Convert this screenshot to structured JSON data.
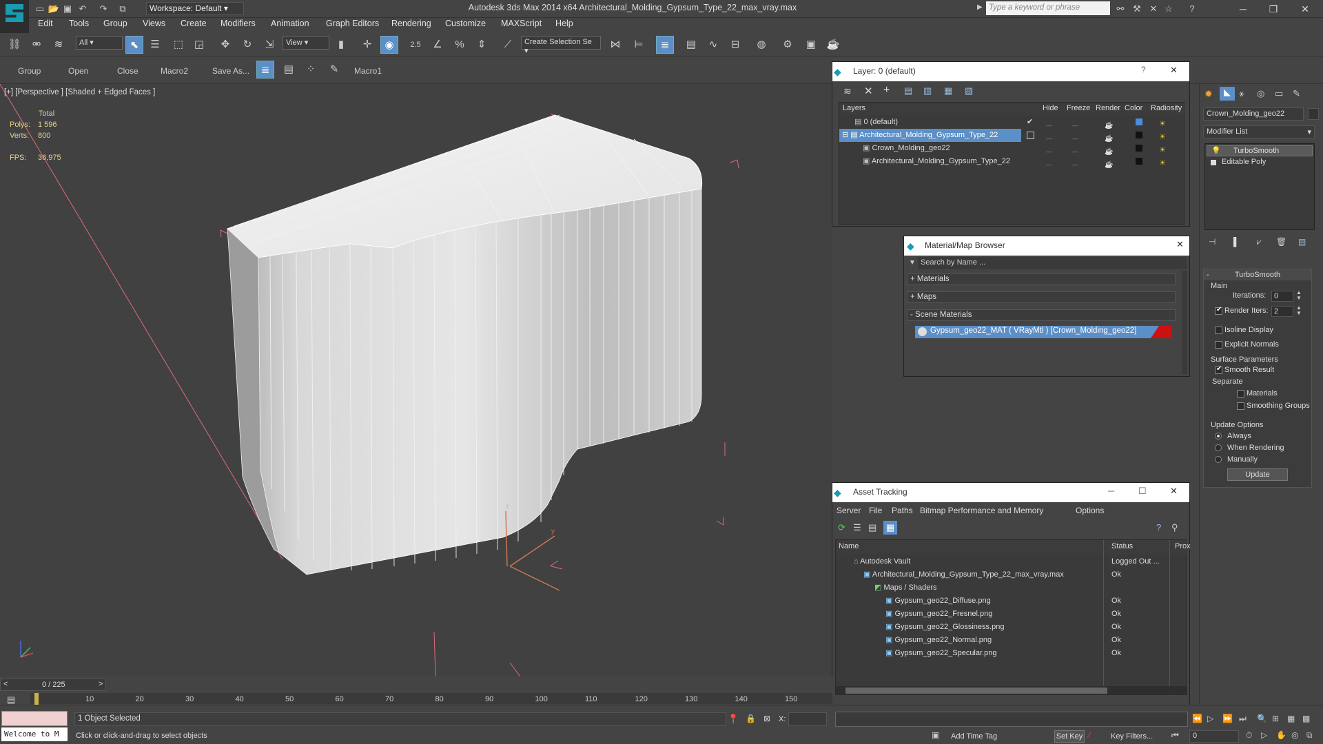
{
  "titlebar": {
    "workspace": "Workspace: Default",
    "app_title": "Autodesk 3ds Max  2014 x64     Architectural_Molding_Gypsum_Type_22_max_vray.max",
    "search_placeholder": "Type a keyword or phrase"
  },
  "menu": [
    "Edit",
    "Tools",
    "Group",
    "Views",
    "Create",
    "Modifiers",
    "Animation",
    "Graph Editors",
    "Rendering",
    "Customize",
    "MAXScript",
    "Help"
  ],
  "toolbar": {
    "selection_filter": "All",
    "ref_coord": "View",
    "snap_value": "2.5",
    "named_selection": "Create Selection Se"
  },
  "secondbar": {
    "items": [
      "Group",
      "Open",
      "Close",
      "Macro2",
      "Save As...",
      "Macro1"
    ]
  },
  "viewport": {
    "label": "[+] [Perspective ] [Shaded + Edged Faces ]",
    "stats": {
      "total_label": "Total",
      "polys_label": "Polys:",
      "polys": "1 596",
      "verts_label": "Verts:",
      "verts": "800",
      "fps_label": "FPS:",
      "fps": "36,975"
    }
  },
  "layer_panel": {
    "title": "Layer: 0 (default)",
    "columns": [
      "Layers",
      "Hide",
      "Freeze",
      "Render",
      "Color",
      "Radiosity"
    ],
    "rows": [
      {
        "name": "0 (default)",
        "selected": false
      },
      {
        "name": "Architectural_Molding_Gypsum_Type_22",
        "selected": true
      },
      {
        "name": "Crown_Molding_geo22",
        "selected": false
      },
      {
        "name": "Architectural_Molding_Gypsum_Type_22",
        "selected": false
      }
    ]
  },
  "material_browser": {
    "title": "Material/Map Browser",
    "search_placeholder": "Search by Name ...",
    "sections": [
      "+ Materials",
      "+ Maps",
      "- Scene Materials"
    ],
    "scene_material": "Gypsum_geo22_MAT ( VRayMtl ) [Crown_Molding_geo22]"
  },
  "asset_tracking": {
    "title": "Asset Tracking",
    "menu": [
      "Server",
      "File",
      "Paths",
      "Bitmap Performance and Memory",
      "Options"
    ],
    "columns": [
      "Name",
      "Status",
      "Prox"
    ],
    "rows": [
      {
        "name": "Autodesk Vault",
        "status": "Logged Out ..."
      },
      {
        "name": "Architectural_Molding_Gypsum_Type_22_max_vray.max",
        "status": "Ok"
      },
      {
        "name": "Maps / Shaders",
        "status": ""
      },
      {
        "name": "Gypsum_geo22_Diffuse.png",
        "status": "Ok"
      },
      {
        "name": "Gypsum_geo22_Fresnel.png",
        "status": "Ok"
      },
      {
        "name": "Gypsum_geo22_Glossiness.png",
        "status": "Ok"
      },
      {
        "name": "Gypsum_geo22_Normal.png",
        "status": "Ok"
      },
      {
        "name": "Gypsum_geo22_Specular.png",
        "status": "Ok"
      }
    ]
  },
  "command_panel": {
    "object_name": "Crown_Molding_geo22",
    "modifier_list": "Modifier List",
    "stack": [
      "TurboSmooth",
      "Editable Poly"
    ],
    "rollout_title": "TurboSmooth",
    "main_label": "Main",
    "iterations_label": "Iterations:",
    "iterations": "0",
    "render_iters_label": "Render Iters:",
    "render_iters": "2",
    "isoline_label": "Isoline Display",
    "explicit_normals_label": "Explicit Normals",
    "surface_params_label": "Surface Parameters",
    "smooth_result_label": "Smooth Result",
    "separate_label": "Separate",
    "materials_label": "Materials",
    "smoothing_groups_label": "Smoothing Groups",
    "update_options_label": "Update Options",
    "always_label": "Always",
    "when_rendering_label": "When Rendering",
    "manually_label": "Manually",
    "update_button": "Update"
  },
  "timeline": {
    "frame": "0 / 225",
    "ticks": [
      "10",
      "20",
      "30",
      "40",
      "50",
      "60",
      "70",
      "80",
      "90",
      "100",
      "110",
      "120",
      "130",
      "140",
      "150"
    ]
  },
  "status": {
    "welcome": "Welcome to M",
    "selected": "1 Object Selected",
    "prompt": "Click or click-and-drag to select objects",
    "x_label": "X:",
    "add_time_tag": "Add Time Tag",
    "set_key": "Set Key",
    "key_filters": "Key Filters...",
    "frame_field": "0"
  }
}
